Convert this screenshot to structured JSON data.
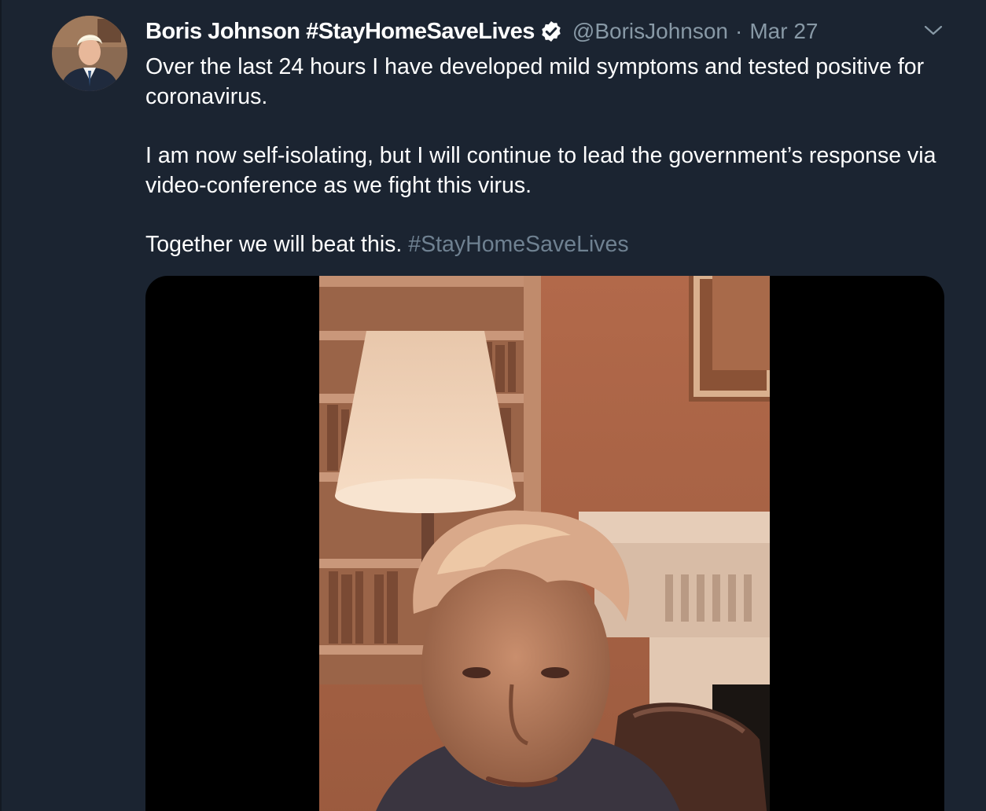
{
  "tweet": {
    "display_name": "Boris Johnson #StayHomeSaveLives",
    "handle": "@BorisJohnson",
    "separator": "·",
    "timestamp": "Mar 27",
    "paragraph_1": "Over the last 24 hours I have developed mild symptoms and tested positive for coronavirus.",
    "paragraph_2": "I am now self-isolating, but I will continue to lead the government’s response via video-conference as we fight this virus.",
    "paragraph_3_text": "Together we will beat this. ",
    "paragraph_3_hashtag": "#StayHomeSaveLives"
  },
  "icons": {
    "verified": "verified-badge-icon",
    "caret": "chevron-down-icon"
  },
  "colors": {
    "background": "#1b2431",
    "text": "#ffffff",
    "secondary_text": "#8899a6",
    "hashtag": "#6f8191",
    "media_background": "#000000"
  }
}
